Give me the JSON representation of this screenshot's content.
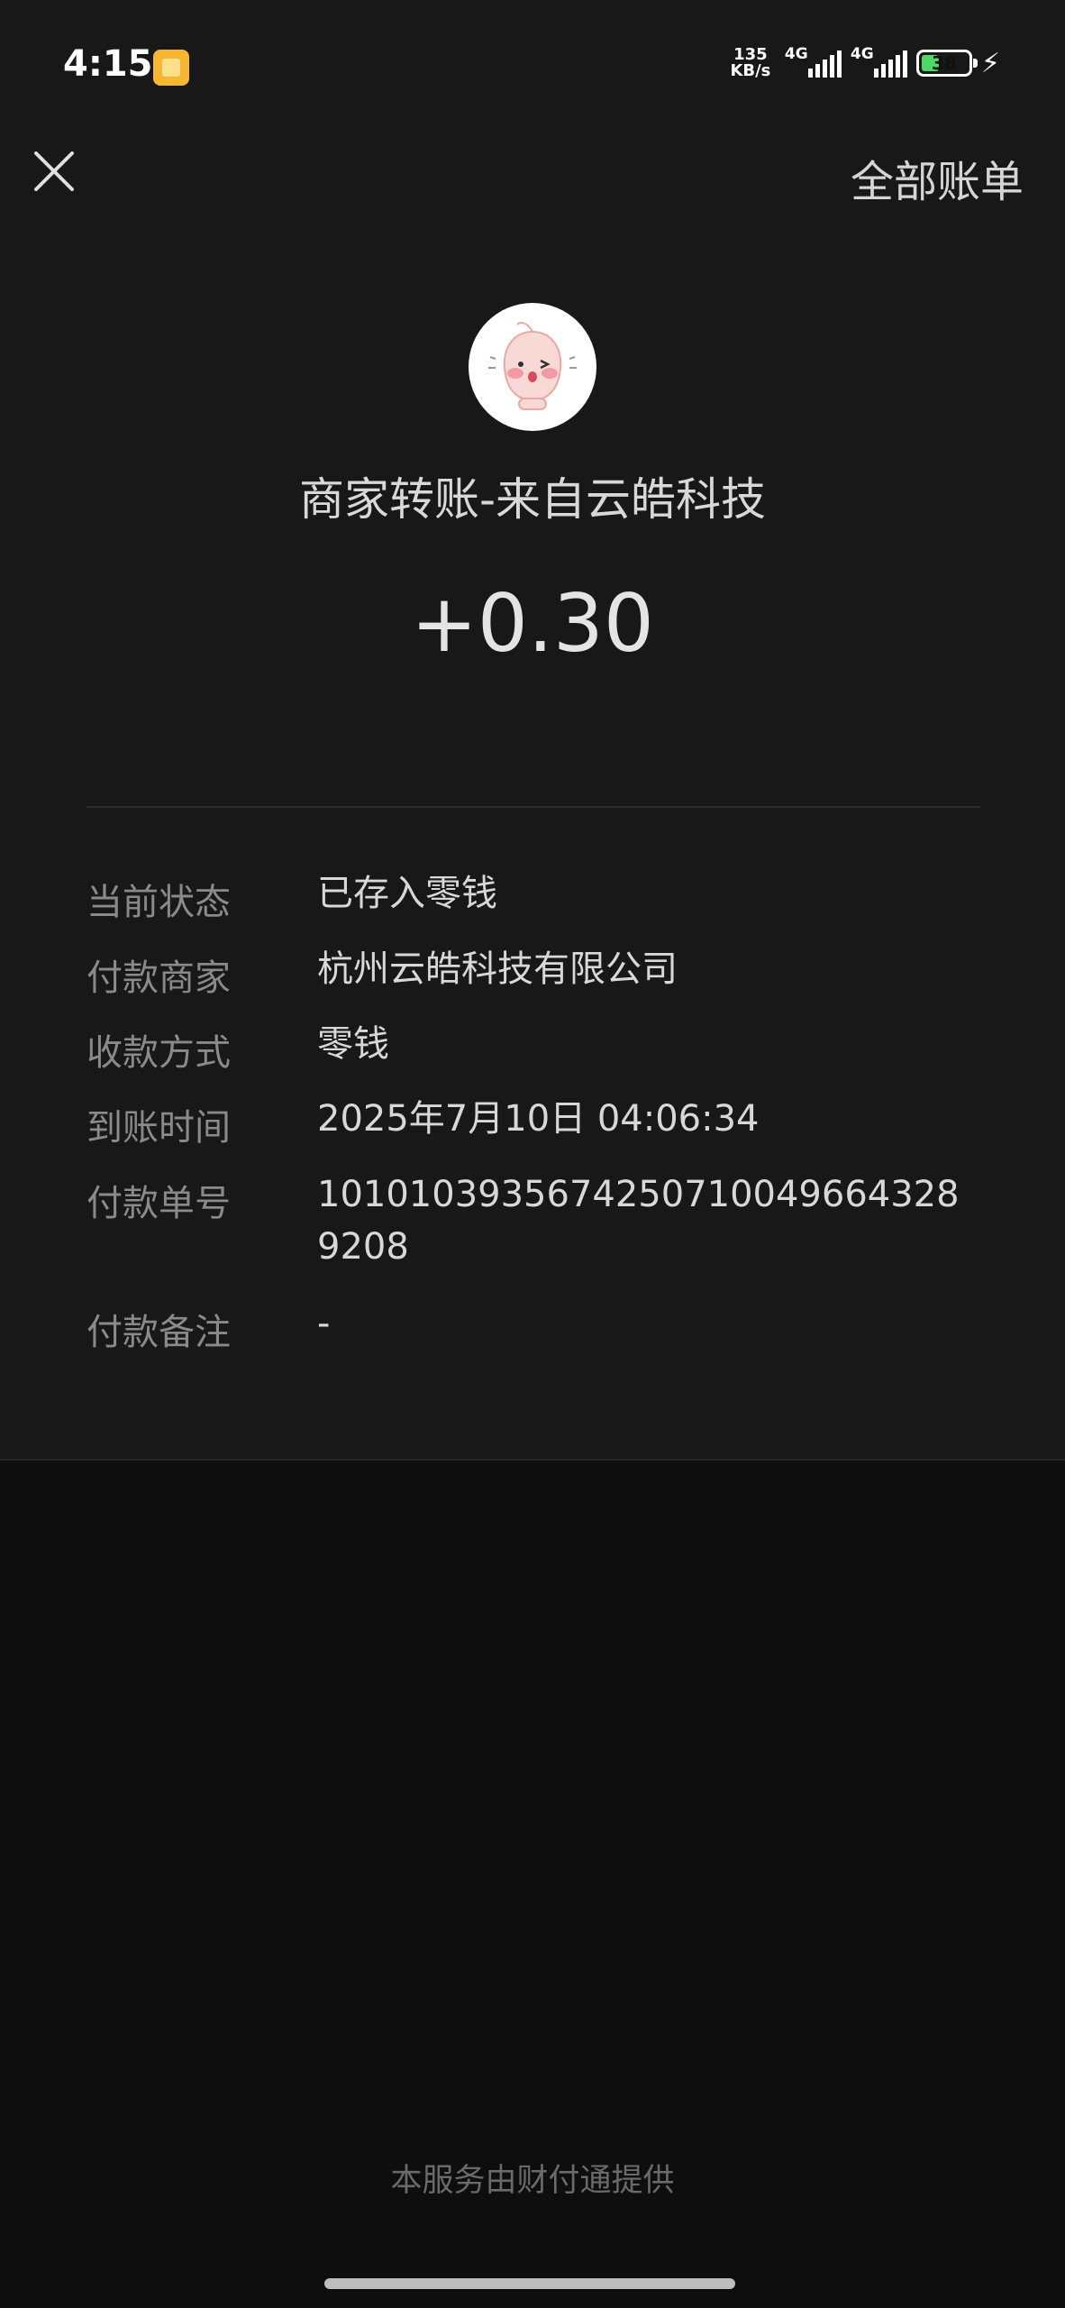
{
  "status_bar": {
    "time": "4:15",
    "net_speed_value": "135",
    "net_speed_unit": "KB/s",
    "signal1_label": "4G",
    "signal2_label": "4G",
    "battery": "38",
    "battery_level": 0.38
  },
  "header": {
    "all_bills": "全部账单"
  },
  "transaction": {
    "title": "商家转账-来自云皓科技",
    "amount": "+0.30"
  },
  "details": [
    {
      "label": "当前状态",
      "value": "已存入零钱"
    },
    {
      "label": "付款商家",
      "value": "杭州云皓科技有限公司"
    },
    {
      "label": "收款方式",
      "value": "零钱"
    },
    {
      "label": "到账时间",
      "value": "2025年7月10日 04:06:34"
    },
    {
      "label": "付款单号",
      "value": "10101039356742507100496643289208"
    },
    {
      "label": "付款备注",
      "value": "-"
    }
  ],
  "footer": {
    "provider": "本服务由财付通提供"
  },
  "colors": {
    "background": "#0e0e0e",
    "card": "#181818",
    "label": "#8a8a8a",
    "value": "#d8d8d8"
  }
}
